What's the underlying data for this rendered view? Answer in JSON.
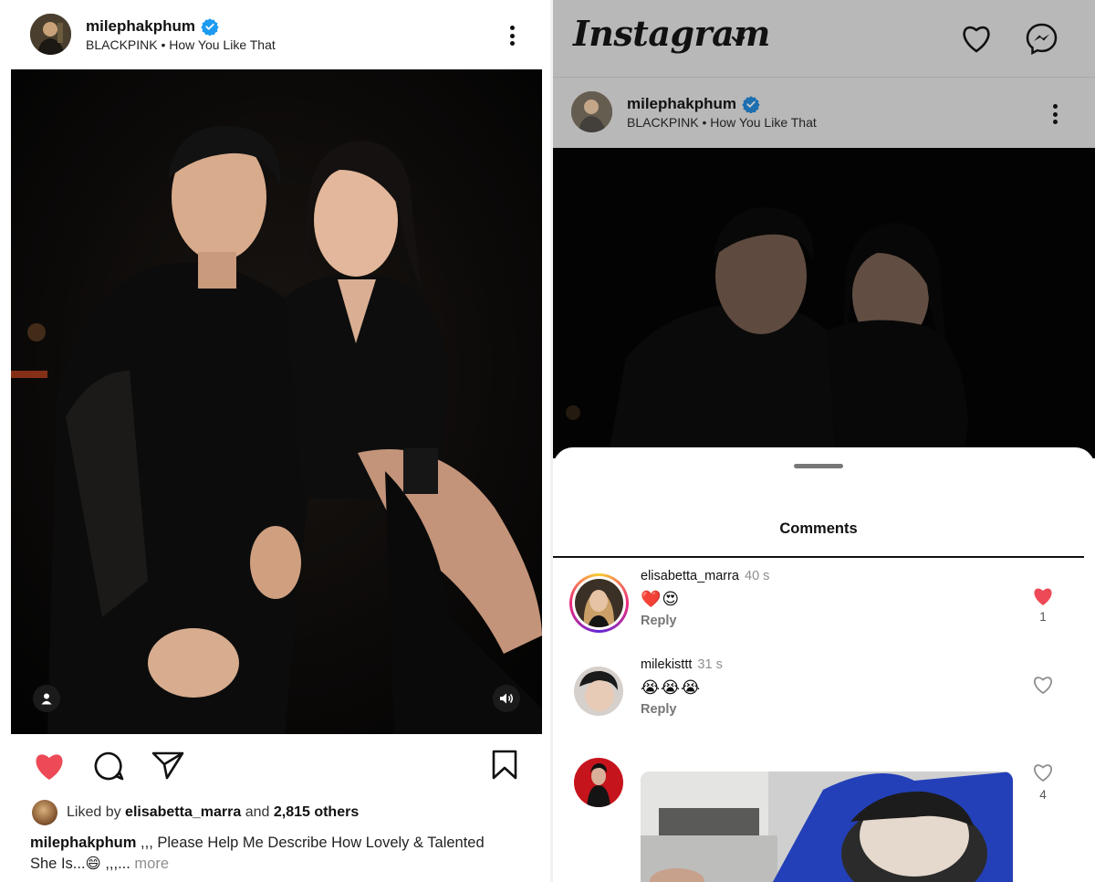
{
  "post": {
    "username": "milephakphum",
    "subtitle": "BLACKPINK • How You Like That",
    "liked_by_prefix": "Liked by",
    "liked_by_user": "elisabetta_marra",
    "liked_by_and": "and",
    "liked_by_others": "2,815 others",
    "caption_user": "milephakphum",
    "caption_text": ",,, Please Help Me Describe How Lovely & Talented She Is...😄 ,,,...",
    "caption_more": "more"
  },
  "app": {
    "logo": "Instagram"
  },
  "comments_sheet": {
    "title": "Comments",
    "items": [
      {
        "username": "elisabetta_marra",
        "time": "40 s",
        "text": "❤️😍",
        "reply": "Reply",
        "liked": true,
        "like_count": "1"
      },
      {
        "username": "milekisttt",
        "time": "31 s",
        "text": "😭😭😭",
        "reply": "Reply",
        "liked": false,
        "like_count": ""
      },
      {
        "username": "",
        "time": "",
        "text": "",
        "reply": "",
        "liked": false,
        "like_count": "4"
      }
    ]
  },
  "colors": {
    "like_red": "#ed4956",
    "verified_blue": "#1d9bf0",
    "muted_text": "#8e8e8e",
    "dim_overlay": "#b8b8b8"
  },
  "icons": {
    "like": "heart-filled-icon",
    "comment": "comment-bubble-icon",
    "share": "paper-plane-icon",
    "save": "bookmark-icon",
    "notifications": "heart-outline-icon",
    "messenger": "messenger-icon",
    "more": "more-vertical-icon",
    "tag": "user-tag-icon",
    "audio": "speaker-icon"
  }
}
